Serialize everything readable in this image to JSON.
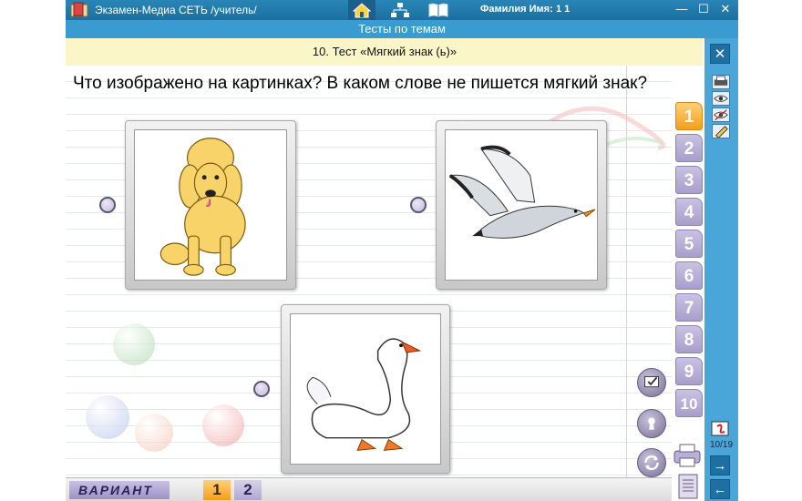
{
  "titlebar": {
    "app_title": "Экзамен-Медиа СЕТЬ /учитель/",
    "user_label": "Фамилия Имя:",
    "user_value": "1 1",
    "minimize": "—",
    "maximize": "☐",
    "close": "✕"
  },
  "subtitle": "Тесты по темам",
  "test_title": "10. Тест «Мягкий знак (ь)»",
  "question": "Что изображено на картинках? В каком слове не пишется мягкий знак?",
  "pictures": [
    {
      "icon": "poodle-icon"
    },
    {
      "icon": "seagull-icon"
    },
    {
      "icon": "swan-icon"
    }
  ],
  "tabs": [
    "1",
    "2",
    "3",
    "4",
    "5",
    "6",
    "7",
    "8",
    "9",
    "10"
  ],
  "active_tab": "1",
  "rightbar": {
    "close": "✕",
    "page_counter": "10/19",
    "next": "→",
    "prev": "←"
  },
  "bottombar": {
    "variant_label": "ВАРИАНТ",
    "variants": [
      "1",
      "2"
    ],
    "active_variant": "1"
  },
  "colors": {
    "title_bar": "#1a6fa0",
    "subtitle_bar": "#3a9bd0",
    "header_bg": "#fbf6c8",
    "tab_active": "#f59e1b",
    "tab_inactive": "#a79fcb"
  }
}
